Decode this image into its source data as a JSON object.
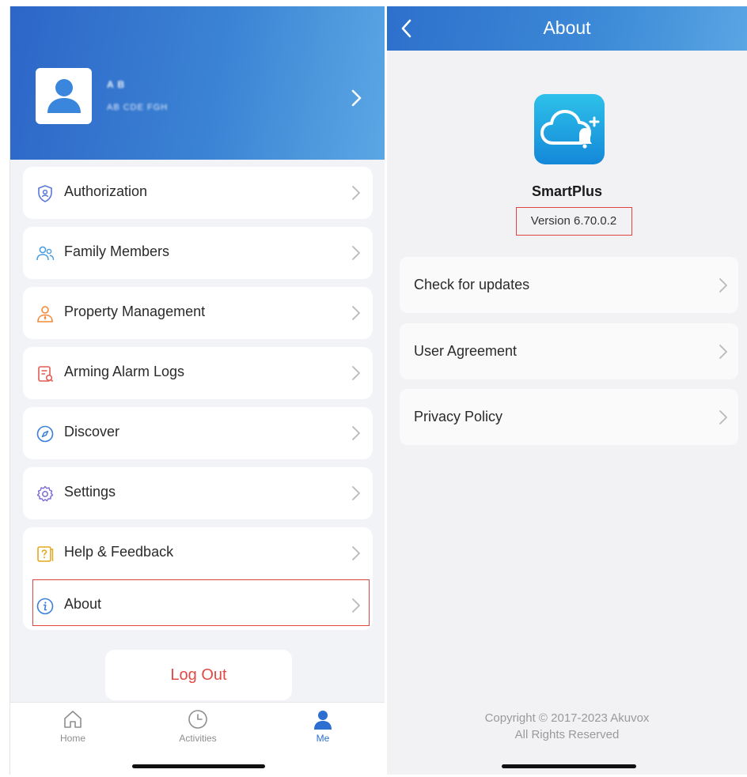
{
  "left": {
    "profile": {
      "name_text": "A B",
      "sub_text": "AB CDE FGH"
    },
    "menu": {
      "authorization": "Authorization",
      "family_members": "Family Members",
      "property_management": "Property Management",
      "arming_alarm_logs": "Arming Alarm Logs",
      "discover": "Discover",
      "settings": "Settings",
      "help_feedback": "Help & Feedback",
      "about": "About"
    },
    "logout_label": "Log Out",
    "tabs": {
      "home": "Home",
      "activities": "Activities",
      "me": "Me"
    },
    "active_tab": "Me"
  },
  "right": {
    "title": "About",
    "app_name": "SmartPlus",
    "version": "Version 6.70.0.2",
    "items": {
      "check_updates": "Check for updates",
      "user_agreement": "User Agreement",
      "privacy_policy": "Privacy Policy"
    },
    "copyright_line1": "Copyright © 2017-2023 Akuvox",
    "copyright_line2": "All Rights Reserved"
  },
  "colors": {
    "header_blue": "#2d66c8",
    "accent_blue": "#2d6fd0",
    "logout_red": "#e04a45",
    "highlight_red": "#e0463f"
  }
}
